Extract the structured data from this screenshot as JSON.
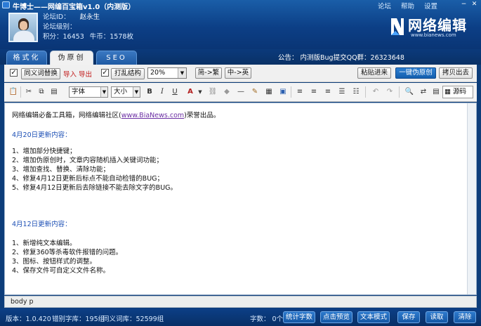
{
  "app": {
    "title": "牛博士——网编百宝箱v1.0（内测版）",
    "menu": [
      "论坛",
      "帮助",
      "设置"
    ]
  },
  "user": {
    "id_label": "论坛ID：",
    "id_value": "赵永生",
    "level_label": "论坛级别：",
    "level_value": "",
    "points_label": "积分：",
    "points_value": "16453",
    "coins_label": "牛币：",
    "coins_value": "1578枚"
  },
  "logo": {
    "text": "网络编辑",
    "url": "www.bianews.com"
  },
  "tabs": [
    {
      "label": "格式化",
      "active": false
    },
    {
      "label": "伪原创",
      "active": true
    },
    {
      "label": "SEO",
      "active": false
    }
  ],
  "notice": "公告：  内测版Bug提交QQ群：26323648",
  "options": {
    "synonym_replace": "同义词替换",
    "synonym_checked": true,
    "import_export": "导入 导出",
    "shuffle_structure": "打乱结构",
    "shuffle_checked": true,
    "percent": "20%",
    "simp_to_trad": "简->繁",
    "cn_to_en": "中->英",
    "paste_in": "粘贴进来",
    "one_click": "一键伪原创",
    "copy_out": "拷贝出去"
  },
  "toolbar": {
    "font": "字体",
    "size": "大小",
    "source": "源码"
  },
  "editor": {
    "intro_prefix": "网络编辑必备工具箱，网络编辑社区(",
    "intro_link": "www.BiaNews.com",
    "intro_suffix": ")荣誉出品。",
    "section1_title": "4月20日更新内容：",
    "section1_items": [
      "1、增加部分快捷键；",
      "2、增加伪原创时，文章内容随机插入关键词功能；",
      "3、增加查找、替换、清除功能；",
      "4、修复4月12日更新后标点不能自动检错的BUG；",
      "5、修复4月12日更新后去除链接不能去除文字的BUG。"
    ],
    "section2_title": "4月12日更新内容：",
    "section2_items": [
      "1、新增纯文本编辑。",
      "2、修复360等杀毒软件报错的问题。",
      "3、图标、按钮样式的调整。",
      "4、保存文件可自定义文件名称。"
    ]
  },
  "pathbar": {
    "tags": "body  p"
  },
  "status": {
    "version": "版本：1.0.420",
    "typo_lib": "错别字库：195组",
    "synonym_lib": "同义词库：52599组",
    "char_count": "字数：  0个"
  },
  "bottom_buttons": [
    "统计字数",
    "点击预览",
    "文本模式",
    "保存",
    "读取",
    "清除"
  ]
}
